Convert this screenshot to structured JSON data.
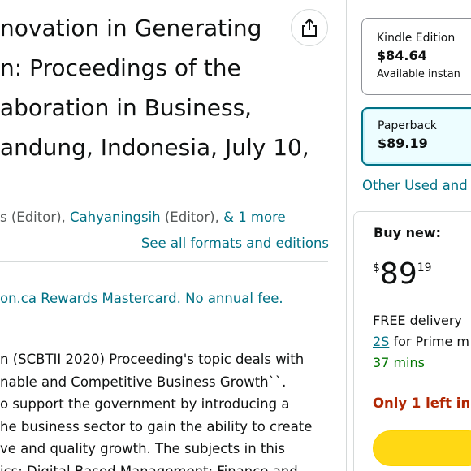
{
  "product": {
    "title_lines": [
      "novation in Generating",
      "n: Proceedings of the",
      "aboration in Business,",
      "andung, Indonesia, July 10,"
    ],
    "authors": {
      "prefix": "s (Editor), ",
      "author2": "Cahyaningsih",
      "author2_role": " (Editor), ",
      "more": "& 1 more"
    },
    "see_all_formats": "See all formats and editions",
    "rewards_text": "on.ca Rewards Mastercard. No annual fee.",
    "description_lines": [
      "n (SCBTII 2020) Proceeding's topic deals with",
      "nable and Competitive Business Growth``.",
      "o support the government by introducing a",
      "he business sector to gain the ability to create",
      "ve and quality growth. The subjects in this",
      "ics: Digital-Based Management; Finance and"
    ]
  },
  "formats": {
    "kindle": {
      "name": "Kindle Edition",
      "price": "$84.64",
      "sub": "Available instan"
    },
    "paperback": {
      "name": "Paperback",
      "price": "$89.19"
    }
  },
  "other_used": "Other Used and",
  "buybox": {
    "label": "Buy new:",
    "price_symbol": "$",
    "price_whole": "89",
    "price_fraction": "19",
    "delivery_line1": "FREE delivery",
    "delivery_link": "2S",
    "delivery_line2_rest": " for Prime m",
    "delivery_line3": "37 mins",
    "stock": "Only 1 left in"
  },
  "colors": {
    "link": "#007185",
    "price_red": "#b12704",
    "green": "#007600",
    "cart_button": "#ffd814",
    "selected_border": "#007185"
  },
  "icons": {
    "share": "share-icon"
  }
}
